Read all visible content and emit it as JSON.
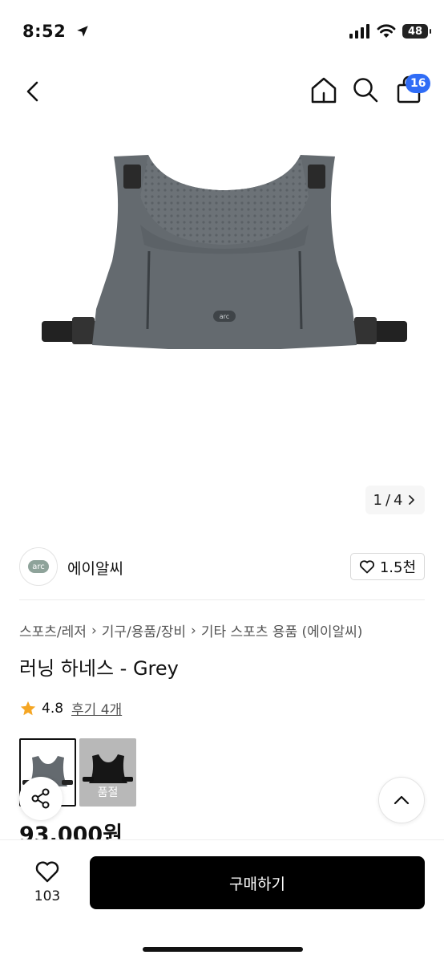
{
  "status_bar": {
    "time": "8:52",
    "battery": "48",
    "icons": [
      "location-arrow-icon",
      "cellular-signal-icon",
      "wifi-icon",
      "battery-icon"
    ]
  },
  "nav": {
    "icons": [
      "back-icon",
      "home-icon",
      "search-icon",
      "shopping-bag-icon"
    ],
    "cart_count": "16"
  },
  "gallery": {
    "current_page": "1",
    "total_pages": "4",
    "page_separator": "/",
    "image_alt": "running harness vest grey"
  },
  "brand": {
    "logo_text": "arc",
    "name": "에이알씨",
    "like_count": "1.5천"
  },
  "breadcrumb": [
    "스포츠/레저",
    "기구/용품/장비",
    "기타 스포츠 용품 (에이알씨)"
  ],
  "product": {
    "title": "러닝 하네스 - Grey",
    "rating": "4.8",
    "reviews": "후기 4개",
    "price": "93,000원"
  },
  "options": [
    {
      "color": "grey",
      "selected": true,
      "label": ""
    },
    {
      "color": "black",
      "selected": false,
      "label": "품절"
    }
  ],
  "bottom_bar": {
    "wish_count": "103",
    "buy_label": "구매하기"
  },
  "colors": {
    "accent_badge": "#2f6cf6",
    "star": "#f5a623",
    "buy_button": "#000000"
  }
}
